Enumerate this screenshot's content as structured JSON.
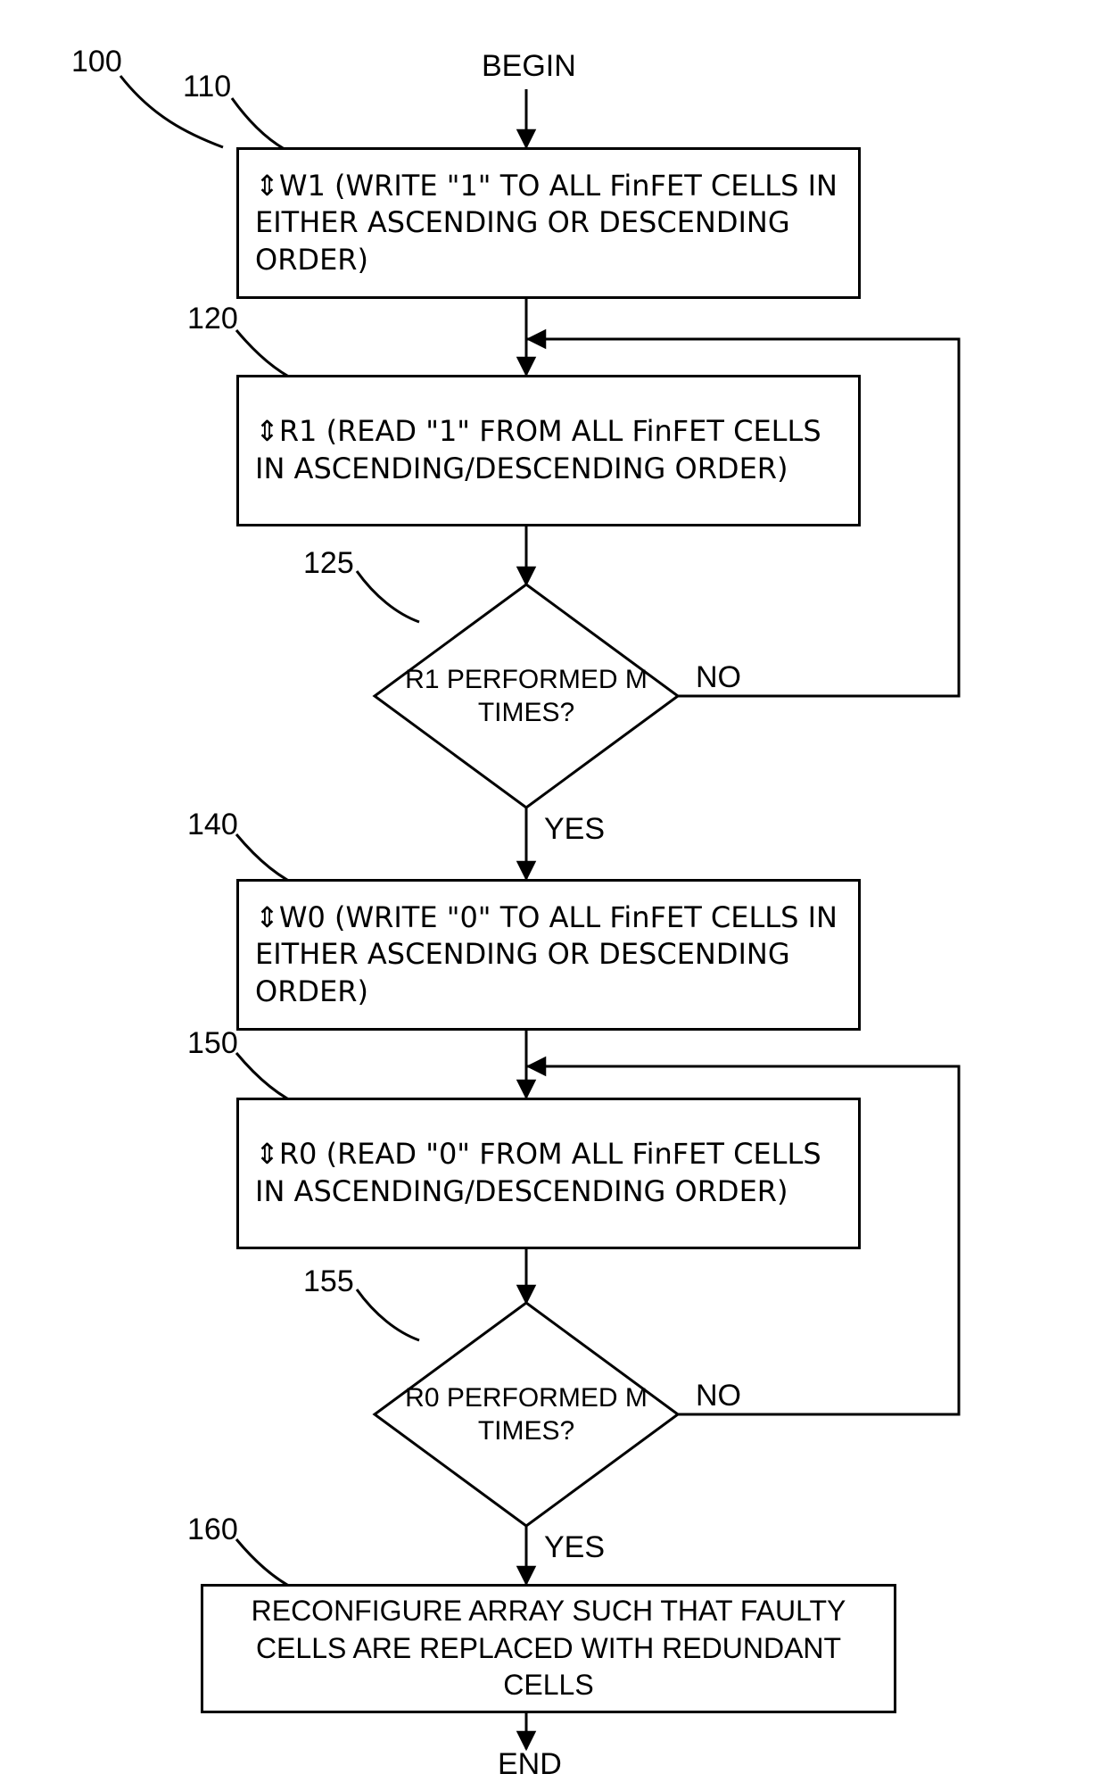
{
  "chart_data": {
    "type": "flowchart",
    "nodes": [
      {
        "id": "begin",
        "type": "terminator",
        "label": "BEGIN",
        "ref": ""
      },
      {
        "id": "w1",
        "type": "process",
        "ref": "110",
        "label": "↕W1 (WRITE \"1\" TO ALL FinFET CELLS IN EITHER ASCENDING OR DESCENDING ORDER)"
      },
      {
        "id": "r1",
        "type": "process",
        "ref": "120",
        "label": "↕R1 (READ \"1\" FROM ALL FinFET CELLS IN ASCENDING/DESCENDING ORDER)"
      },
      {
        "id": "d125",
        "type": "decision",
        "ref": "125",
        "label": "R1 PERFORMED M TIMES?",
        "yes_to": "w0",
        "no_to": "r1"
      },
      {
        "id": "w0",
        "type": "process",
        "ref": "140",
        "label": "↕W0 (WRITE \"0\" TO ALL FinFET CELLS IN EITHER ASCENDING OR DESCENDING ORDER)"
      },
      {
        "id": "r0",
        "type": "process",
        "ref": "150",
        "label": "↕R0 (READ \"0\" FROM ALL FinFET CELLS IN ASCENDING/DESCENDING ORDER)"
      },
      {
        "id": "d155",
        "type": "decision",
        "ref": "155",
        "label": "R0 PERFORMED M TIMES?",
        "yes_to": "reconf",
        "no_to": "r0"
      },
      {
        "id": "reconf",
        "type": "process",
        "ref": "160",
        "label": "RECONFIGURE ARRAY SUCH THAT FAULTY CELLS ARE REPLACED WITH REDUNDANT CELLS"
      },
      {
        "id": "end",
        "type": "terminator",
        "label": "END",
        "ref": ""
      }
    ],
    "edges": [
      {
        "from": "begin",
        "to": "w1"
      },
      {
        "from": "w1",
        "to": "r1"
      },
      {
        "from": "r1",
        "to": "d125"
      },
      {
        "from": "d125",
        "to": "w0",
        "label": "YES"
      },
      {
        "from": "d125",
        "to": "r1",
        "label": "NO"
      },
      {
        "from": "w0",
        "to": "r0"
      },
      {
        "from": "r0",
        "to": "d155"
      },
      {
        "from": "d155",
        "to": "reconf",
        "label": "YES"
      },
      {
        "from": "d155",
        "to": "r0",
        "label": "NO"
      },
      {
        "from": "reconf",
        "to": "end"
      }
    ],
    "figure_ref": "100"
  },
  "labels": {
    "fig100": "100",
    "begin": "BEGIN",
    "end": "END",
    "ref110": "110",
    "ref120": "120",
    "ref125": "125",
    "ref140": "140",
    "ref150": "150",
    "ref155": "155",
    "ref160": "160",
    "w1": "⇕W1 (WRITE \"1\" TO ALL FinFET CELLS IN EITHER ASCENDING OR DESCENDING ORDER)",
    "r1": "⇕R1 (READ \"1\" FROM ALL FinFET CELLS IN ASCENDING/DESCENDING ORDER)",
    "d125": "R1 PERFORMED M TIMES?",
    "w0": "⇕W0 (WRITE \"0\" TO ALL FinFET CELLS IN EITHER ASCENDING OR DESCENDING ORDER)",
    "r0": "⇕R0 (READ \"0\" FROM ALL FinFET CELLS IN ASCENDING/DESCENDING ORDER)",
    "d155": "R0 PERFORMED M TIMES?",
    "reconf": "RECONFIGURE ARRAY SUCH THAT FAULTY CELLS ARE REPLACED WITH REDUNDANT CELLS",
    "yes": "YES",
    "no": "NO"
  }
}
